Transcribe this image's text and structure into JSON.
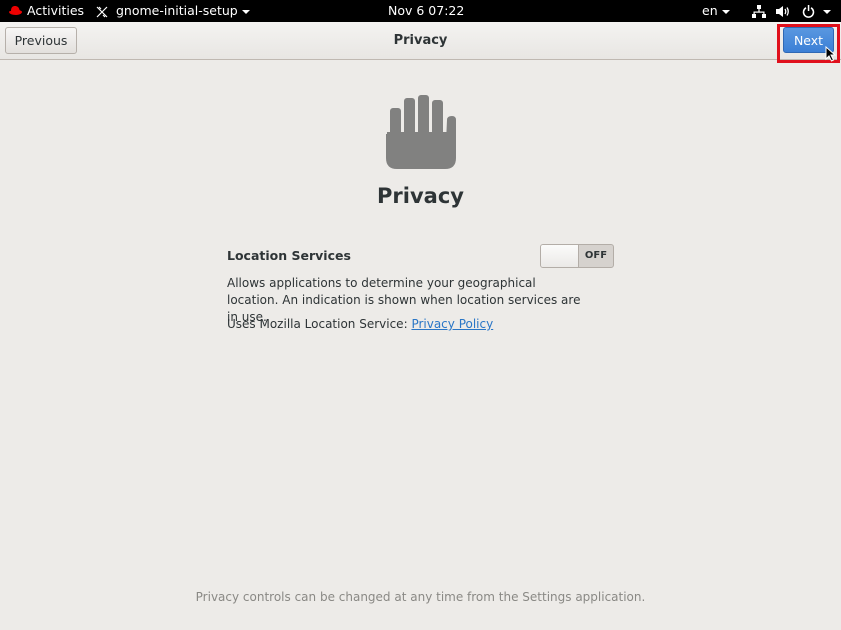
{
  "topbar": {
    "activities": "Activities",
    "app_name": "gnome-initial-setup",
    "clock": "Nov 6  07:22",
    "language": "en"
  },
  "headerbar": {
    "previous_label": "Previous",
    "title": "Privacy",
    "next_label": "Next"
  },
  "main": {
    "heading": "Privacy",
    "location_label": "Location Services",
    "location_switch_state": "OFF",
    "location_description": "Allows applications to determine your geographical location. An indication is shown when location services are in use.",
    "uses_prefix": "Uses Mozilla Location Service: ",
    "privacy_policy_link": "Privacy Policy",
    "footer_note": "Privacy controls can be changed at any time from the Settings application."
  },
  "icons": {
    "topbar": [
      "redhat-icon",
      "app-menu-icon",
      "network-icon",
      "volume-icon",
      "power-icon"
    ],
    "main": "hand-stop-icon"
  },
  "colors": {
    "accent": "#3b7fd6",
    "highlight": "#e0101c",
    "link": "#2a76c6"
  }
}
